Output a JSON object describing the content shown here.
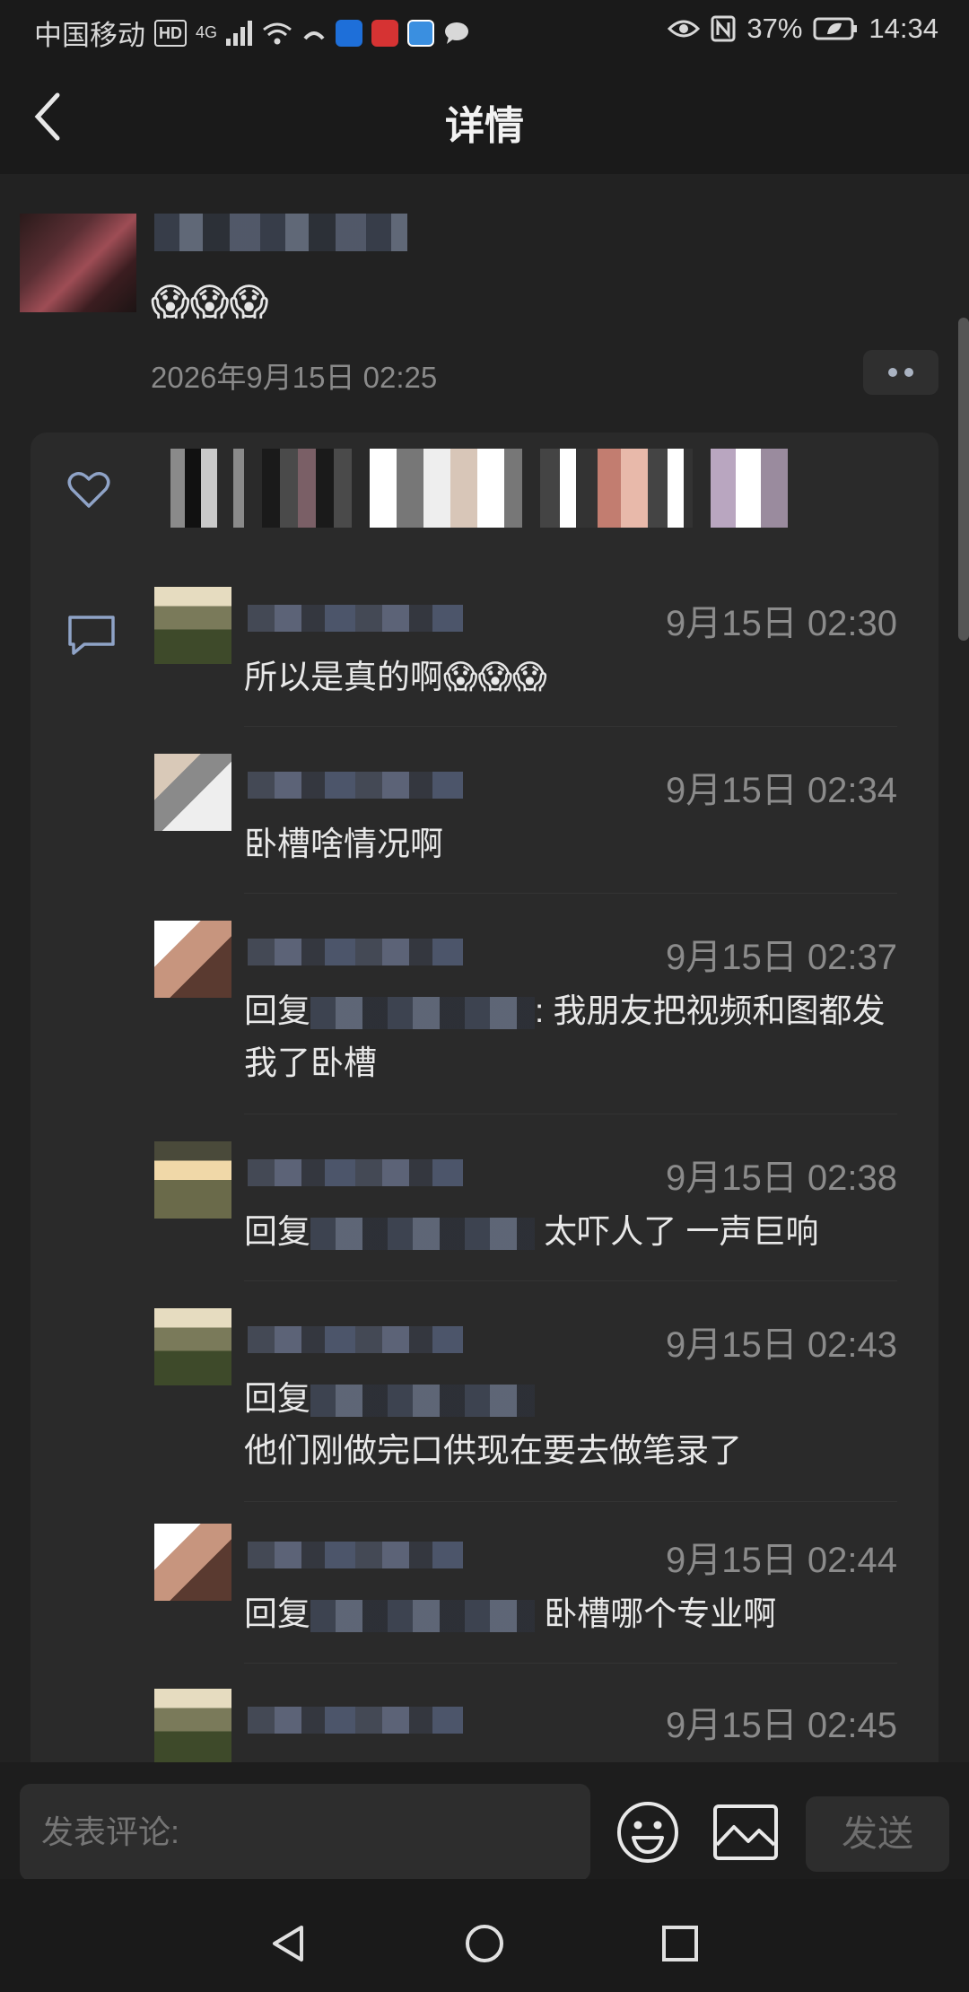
{
  "status_bar": {
    "carrier": "中国移动",
    "hd": "HD",
    "network": "4G",
    "battery": "37%",
    "time": "14:34"
  },
  "header": {
    "title": "详情"
  },
  "post": {
    "emojis": "😱😱😱",
    "time": "2026年9月15日 02:25"
  },
  "comments": [
    {
      "time": "9月15日 02:30",
      "text": "所以是真的啊😱😱😱"
    },
    {
      "time": "9月15日 02:34",
      "text": "卧槽啥情况啊"
    },
    {
      "time": "9月15日 02:37",
      "reply_prefix": "回复",
      "text": ": 我朋友把视频和图都发我了卧槽"
    },
    {
      "time": "9月15日 02:38",
      "reply_prefix": "回复",
      "text": " 太吓人了 一声巨响"
    },
    {
      "time": "9月15日 02:43",
      "reply_prefix": "回复",
      "text": "他们刚做完口供现在要去做笔录了"
    },
    {
      "time": "9月15日 02:44",
      "reply_prefix": "回复",
      "text": " 卧槽哪个专业啊"
    },
    {
      "time": "9月15日 02:45"
    }
  ],
  "input": {
    "placeholder": "发表评论:",
    "send_label": "发送"
  },
  "colors": {
    "background": "#1a1a1a",
    "panel": "#2a2a2a",
    "accent": "#8fa3c7"
  }
}
